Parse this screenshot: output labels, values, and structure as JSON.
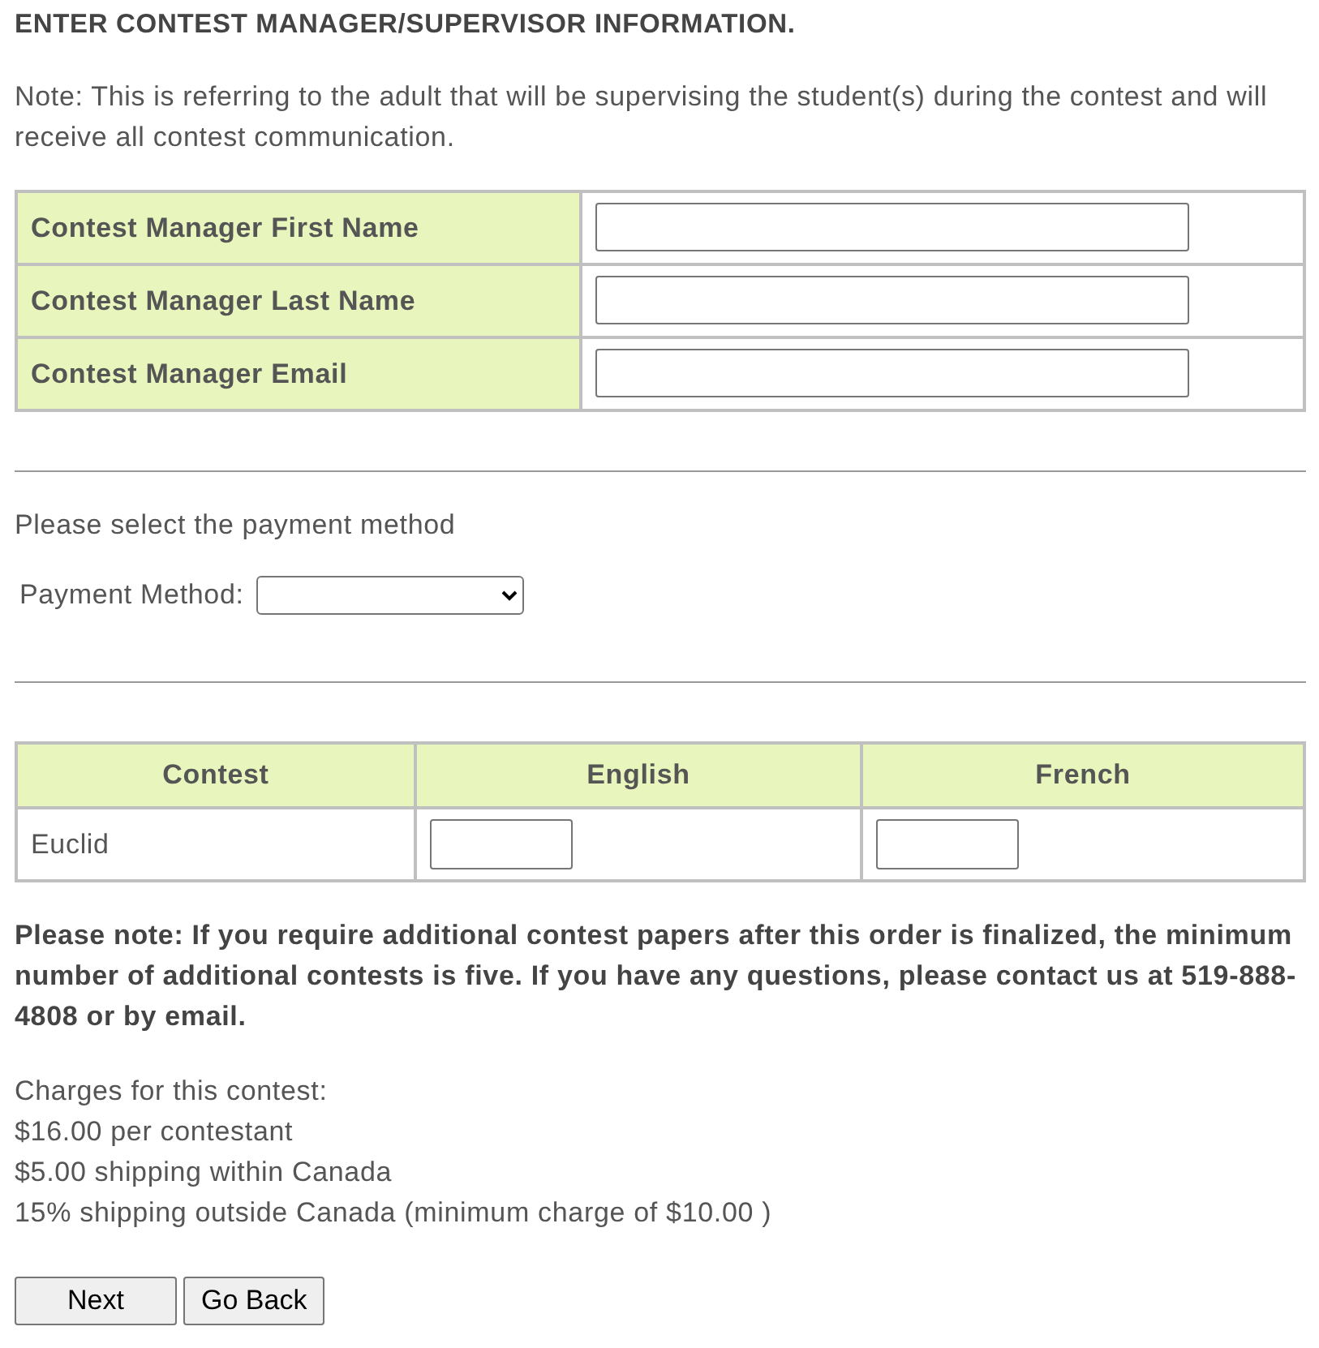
{
  "heading": "ENTER CONTEST MANAGER/SUPERVISOR INFORMATION.",
  "note": "Note: This is referring to the adult that will be supervising the student(s) during the contest and will receive all contest communication.",
  "manager_fields": [
    {
      "label": "Contest Manager First Name"
    },
    {
      "label": "Contest Manager Last Name"
    },
    {
      "label": "Contest Manager Email"
    }
  ],
  "payment": {
    "prompt": "Please select the payment method",
    "label": "Payment Method:"
  },
  "contest_table": {
    "columns": [
      "Contest",
      "English",
      "French"
    ],
    "rows": [
      {
        "contest": "Euclid"
      }
    ]
  },
  "please_note": "Please note: If you require additional contest papers after this order is finalized, the minimum number of additional contests is five. If you have any questions, please contact us at 519-888-4808 or by email.",
  "charges": [
    "Charges for this contest:",
    "$16.00 per contestant",
    "$5.00 shipping within Canada",
    "15% shipping outside Canada (minimum charge of $10.00 )"
  ],
  "buttons": [
    "Next",
    "Go Back"
  ]
}
